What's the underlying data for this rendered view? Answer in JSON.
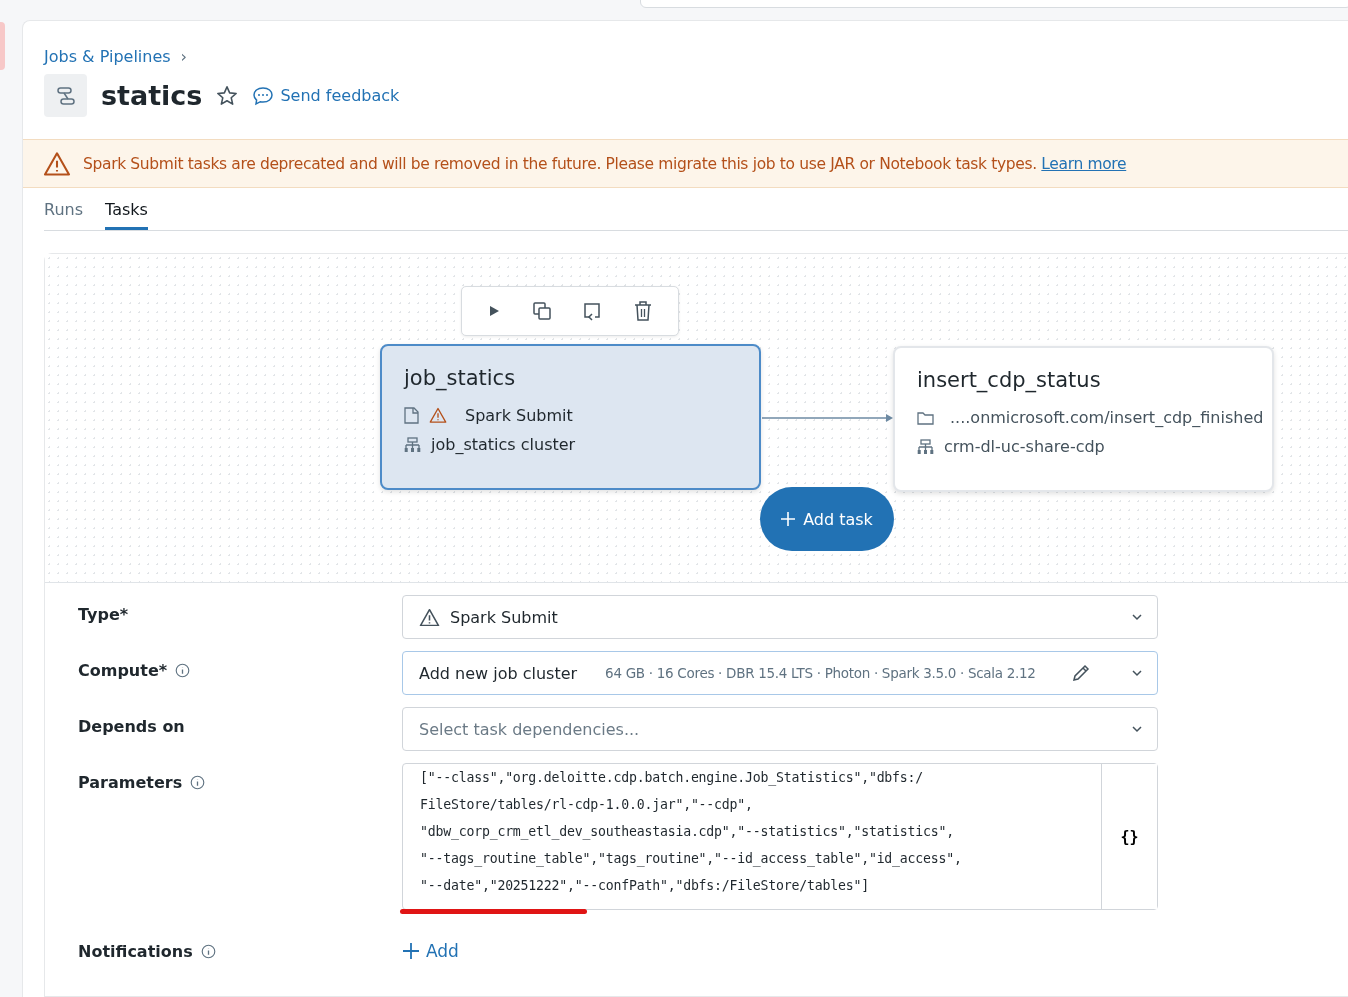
{
  "breadcrumb": {
    "label": "Jobs & Pipelines",
    "separator": "›"
  },
  "header": {
    "title": "statics",
    "starred": false,
    "feedback": "Send feedback"
  },
  "banner": {
    "message": "Spark Submit tasks are deprecated and will be removed in the future. Please migrate this job to use JAR or Notebook task types.",
    "link": "Learn more"
  },
  "tabs": [
    {
      "label": "Runs",
      "selected": false
    },
    {
      "label": "Tasks",
      "selected": true
    }
  ],
  "graph": {
    "nodes": [
      {
        "name": "job_statics",
        "selected": true,
        "kind": "spark",
        "task": "Spark Submit",
        "warning": true,
        "compute": "job_statics cluster"
      },
      {
        "name": "insert_cdp_status",
        "selected": false,
        "kind": "notebook",
        "task": "....onmicrosoft.com/insert_cdp_finished",
        "warning": false,
        "compute": "crm-dl-uc-share-cdp"
      }
    ],
    "add_task": "Add task"
  },
  "form": {
    "type": {
      "label": "Type*",
      "value": "Spark Submit"
    },
    "compute": {
      "label": "Compute*",
      "value": "Add new job cluster",
      "details": "64 GB · 16 Cores · DBR 15.4 LTS · Photon · Spark 3.5.0 · Scala 2.12"
    },
    "depends_on": {
      "label": "Depends on",
      "placeholder": "Select task dependencies..."
    },
    "parameters": {
      "label": "Parameters",
      "lines": [
        "[\"--class\",\"org.deloitte.cdp.batch.engine.Job_Statistics\",\"dbfs:/",
        "FileStore/tables/rl-cdp-1.0.0.jar\",\"--cdp\",",
        "\"dbw_corp_crm_etl_dev_southeastasia.cdp\",\"--statistics\",\"statistics\",",
        "\"--tags_routine_table\",\"tags_routine\",\"--id_access_table\",\"id_access\",",
        "\"--date\",\"20251222\",\"--confPath\",\"dbfs:/FileStore/tables\"]"
      ],
      "format_button": "{}"
    },
    "notifications": {
      "label": "Notifications",
      "add": "Add"
    }
  }
}
